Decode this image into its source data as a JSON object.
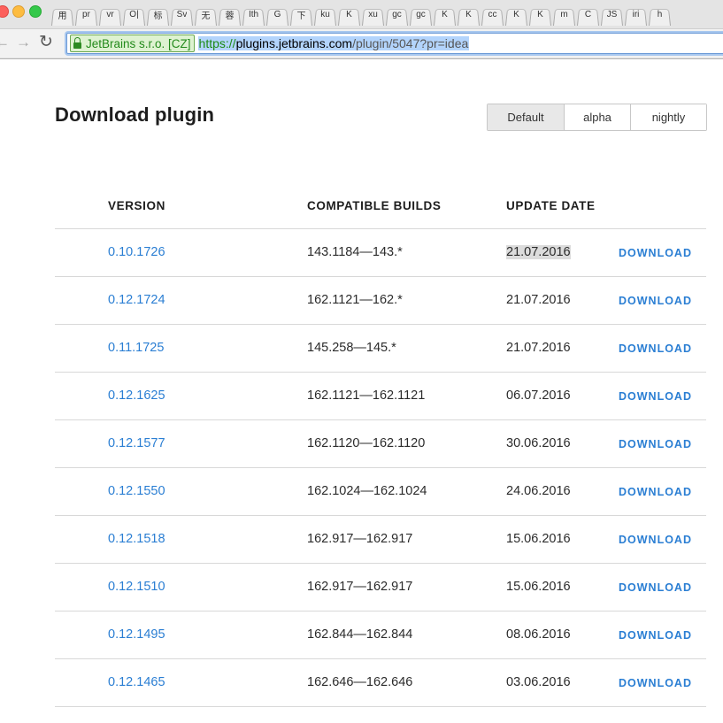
{
  "browser": {
    "tabs": [
      "用",
      "pr",
      "vr",
      "O|",
      "标",
      "Sv",
      "无",
      "蓉",
      "Ith",
      "G",
      "下",
      "ku",
      "K",
      "xu",
      "gc",
      "gc",
      "K",
      "K",
      "cc",
      "K",
      "K",
      "m",
      "C",
      "JS",
      "iri",
      "h"
    ],
    "security_badge": "JetBrains s.r.o. [CZ]",
    "url": {
      "scheme": "https://",
      "host": "plugins.jetbrains.com",
      "path": "/plugin/5047?pr=idea"
    }
  },
  "page": {
    "title": "Download plugin",
    "channels": [
      {
        "label": "Default",
        "active": true
      },
      {
        "label": "alpha",
        "active": false
      },
      {
        "label": "nightly",
        "active": false
      }
    ]
  },
  "table": {
    "headers": {
      "version": "VERSION",
      "builds": "COMPATIBLE BUILDS",
      "date": "UPDATE DATE"
    },
    "rows": [
      {
        "version": "0.10.1726",
        "builds": "143.1184—143.*",
        "date": "21.07.2016",
        "action": "DOWNLOAD",
        "date_highlighted": true
      },
      {
        "version": "0.12.1724",
        "builds": "162.1121—162.*",
        "date": "21.07.2016",
        "action": "DOWNLOAD"
      },
      {
        "version": "0.11.1725",
        "builds": "145.258—145.*",
        "date": "21.07.2016",
        "action": "DOWNLOAD"
      },
      {
        "version": "0.12.1625",
        "builds": "162.1121—162.1121",
        "date": "06.07.2016",
        "action": "DOWNLOAD"
      },
      {
        "version": "0.12.1577",
        "builds": "162.1120—162.1120",
        "date": "30.06.2016",
        "action": "DOWNLOAD"
      },
      {
        "version": "0.12.1550",
        "builds": "162.1024—162.1024",
        "date": "24.06.2016",
        "action": "DOWNLOAD"
      },
      {
        "version": "0.12.1518",
        "builds": "162.917—162.917",
        "date": "15.06.2016",
        "action": "DOWNLOAD"
      },
      {
        "version": "0.12.1510",
        "builds": "162.917—162.917",
        "date": "15.06.2016",
        "action": "DOWNLOAD"
      },
      {
        "version": "0.12.1495",
        "builds": "162.844—162.844",
        "date": "08.06.2016",
        "action": "DOWNLOAD"
      },
      {
        "version": "0.12.1465",
        "builds": "162.646—162.646",
        "date": "03.06.2016",
        "action": "DOWNLOAD"
      }
    ]
  },
  "colors": {
    "link": "#2a7ed3",
    "ev_green": "#238a1b"
  }
}
